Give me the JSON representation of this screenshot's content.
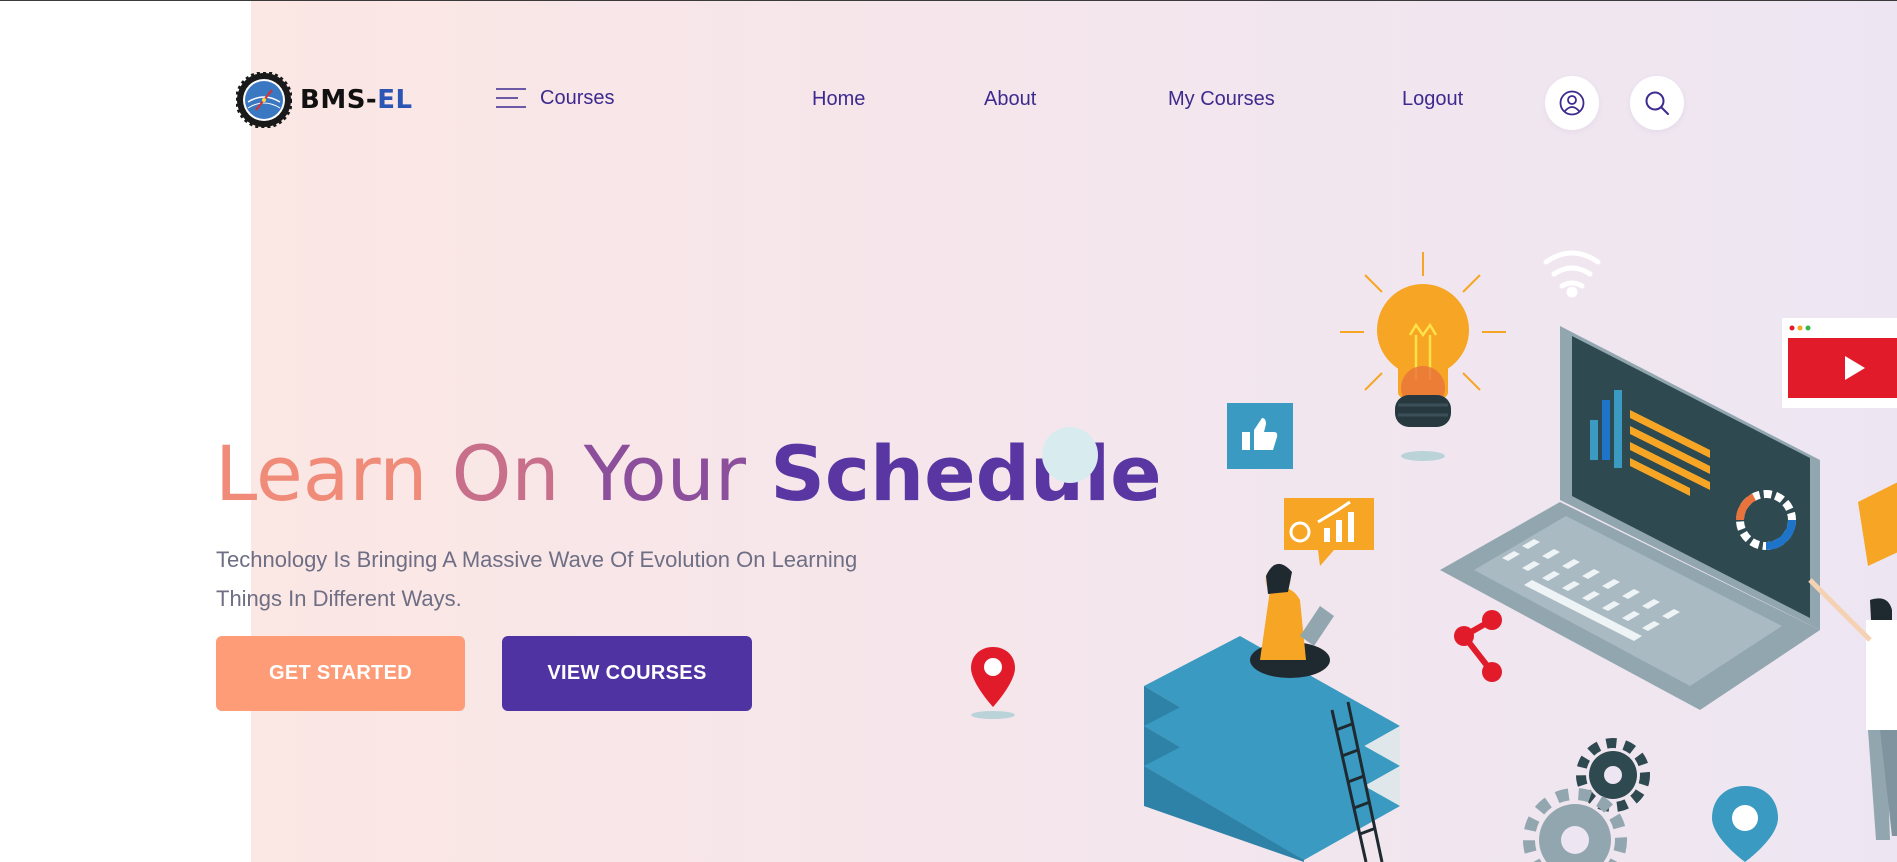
{
  "brand": {
    "name_part1": "BMS-",
    "name_part2": "EL"
  },
  "nav": {
    "courses_label": "Courses",
    "links": [
      {
        "label": "Home"
      },
      {
        "label": "About"
      },
      {
        "label": "My Courses"
      },
      {
        "label": "Logout"
      }
    ],
    "icons": [
      "user-icon",
      "search-icon"
    ]
  },
  "hero": {
    "headline": {
      "word1": "Learn",
      "word2": "On",
      "word3": "Your",
      "word4": "Schedule"
    },
    "subtext_line1": "Technology Is Bringing A Massive Wave Of Evolution On Learning",
    "subtext_line2": "Things In Different Ways.",
    "buttons": {
      "get_started": "GET STARTED",
      "view_courses": "VIEW COURSES"
    }
  },
  "colors": {
    "accent_primary": "#4f33a3",
    "accent_secondary": "#fe9c78",
    "nav_text": "#3d2a8f"
  }
}
